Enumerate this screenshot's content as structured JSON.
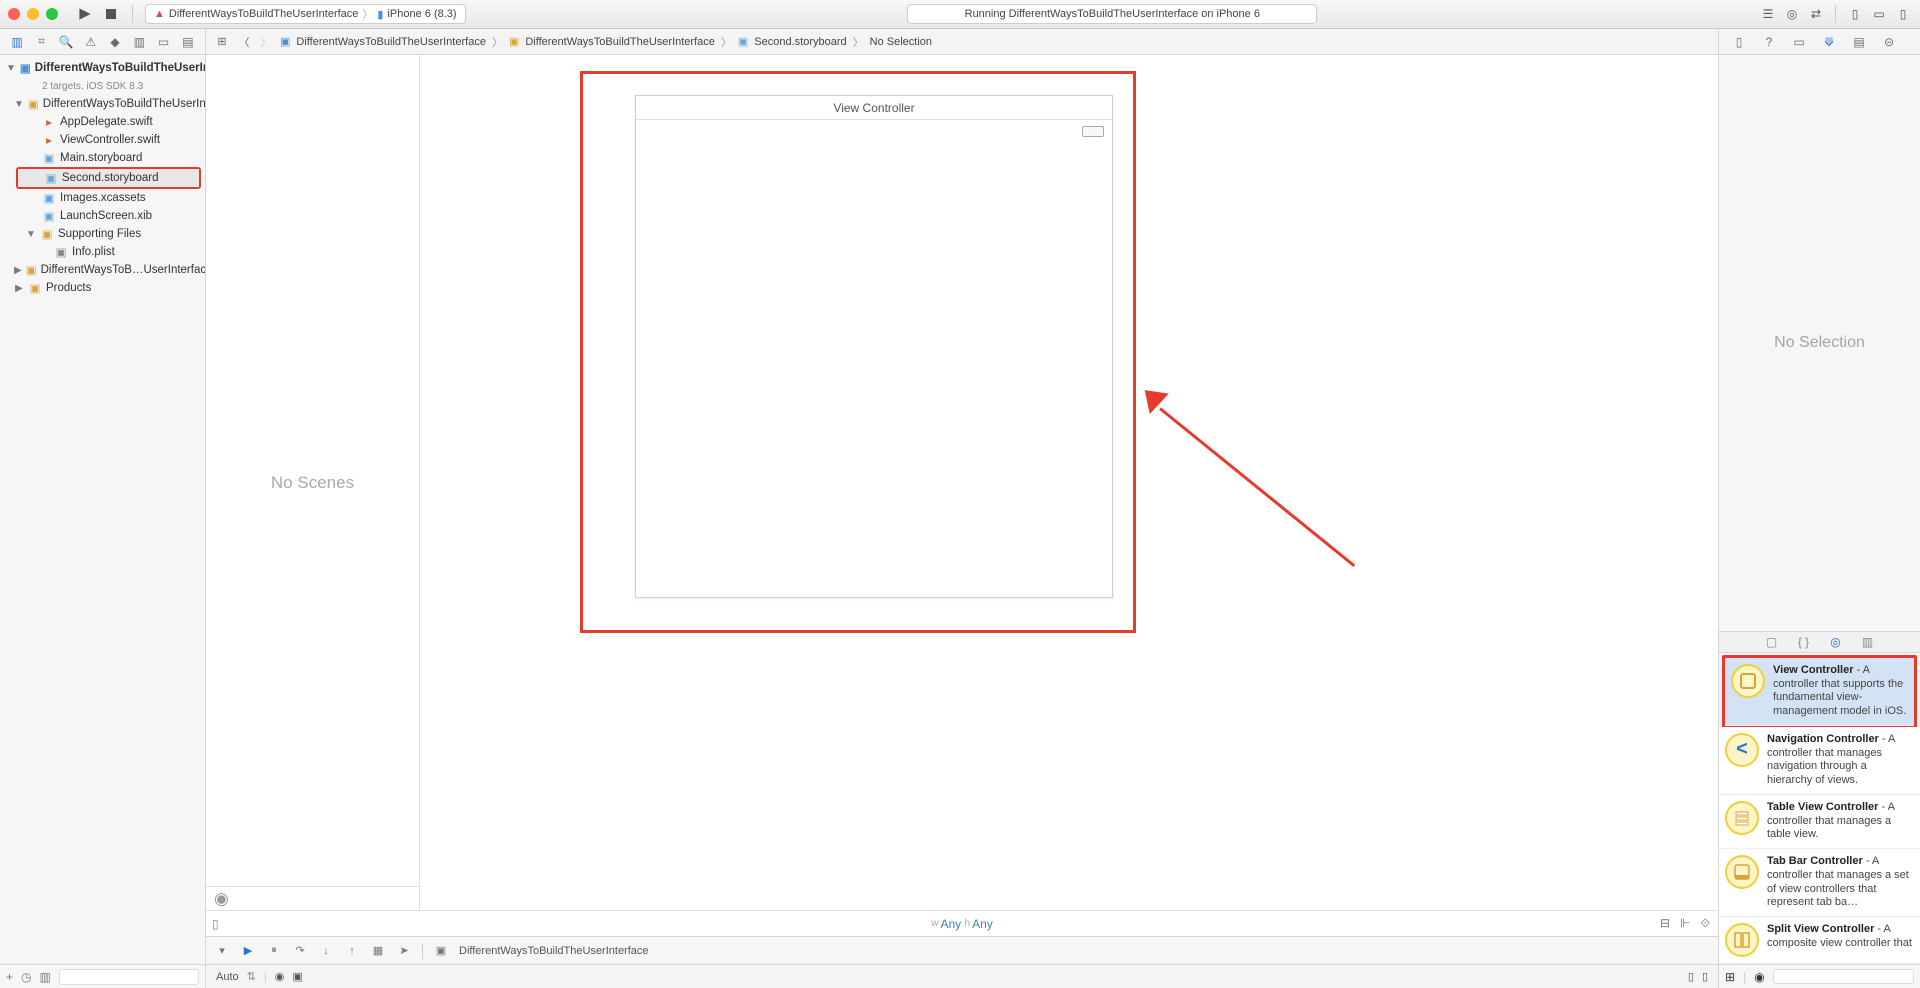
{
  "toolbar": {
    "scheme_project": "DifferentWaysToBuildTheUserInterface",
    "scheme_device": "iPhone 6 (8.3)",
    "status": "Running DifferentWaysToBuildTheUserInterface on iPhone 6"
  },
  "breadcrumb": {
    "items": [
      "DifferentWaysToBuildTheUserInterface",
      "DifferentWaysToBuildTheUserInterface",
      "Second.storyboard",
      "No Selection"
    ]
  },
  "navigator": {
    "project": "DifferentWaysToBuildTheUserInterface",
    "project_sub": "2 targets, iOS SDK 8.3",
    "group": "DifferentWaysToBuildTheUserInterface",
    "files": [
      "AppDelegate.swift",
      "ViewController.swift",
      "Main.storyboard",
      "Second.storyboard",
      "Images.xcassets",
      "LaunchScreen.xib"
    ],
    "supporting": "Supporting Files",
    "infoplist": "Info.plist",
    "tests": "DifferentWaysToB…UserInterfaceTests",
    "products": "Products"
  },
  "outline": {
    "placeholder": "No Scenes"
  },
  "canvas": {
    "vc_title": "View Controller"
  },
  "sizeclass": {
    "w": "Any",
    "h": "Any",
    "wlabel": "w",
    "hlabel": "h"
  },
  "debug": {
    "process": "DifferentWaysToBuildTheUserInterface"
  },
  "bottom": {
    "auto": "Auto"
  },
  "inspector": {
    "placeholder": "No Selection"
  },
  "library": {
    "items": [
      {
        "title": "View Controller",
        "desc": " - A controller that supports the fundamental view-management model in iOS."
      },
      {
        "title": "Navigation Controller",
        "desc": " - A controller that manages navigation through a hierarchy of views."
      },
      {
        "title": "Table View Controller",
        "desc": " - A controller that manages a table view."
      },
      {
        "title": "Tab Bar Controller",
        "desc": " - A controller that manages a set of view controllers that represent tab ba…"
      },
      {
        "title": "Split View Controller",
        "desc": " - A composite view controller that"
      }
    ]
  }
}
